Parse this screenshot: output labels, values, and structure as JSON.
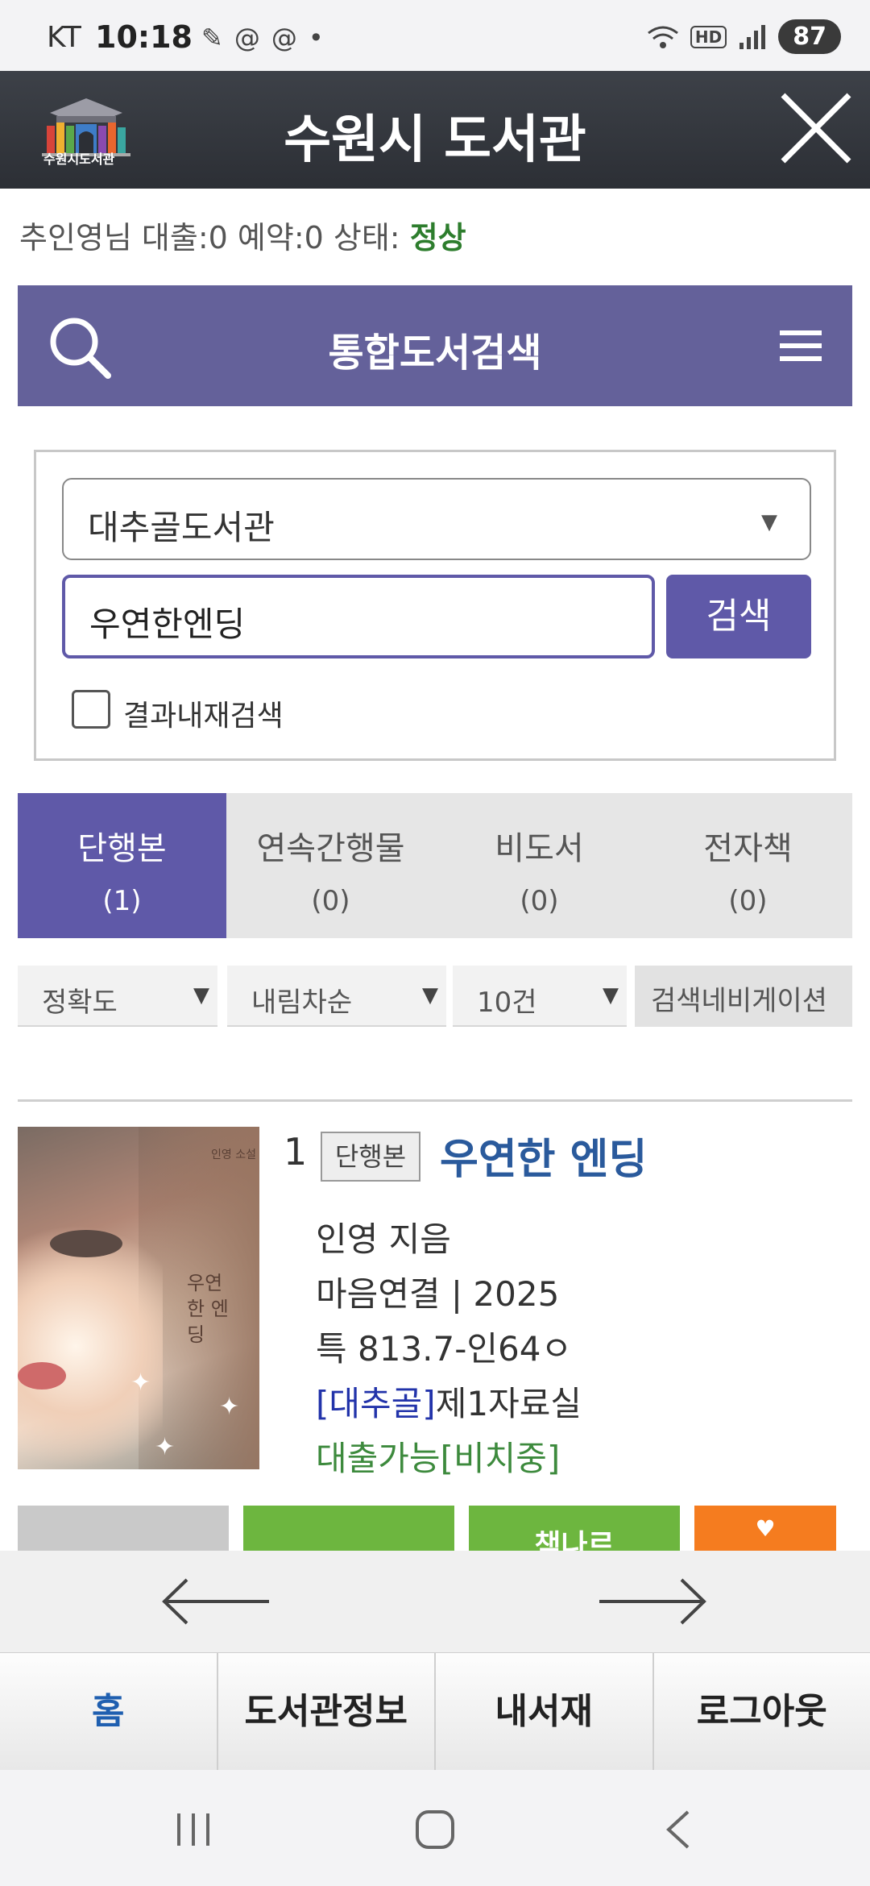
{
  "status_bar": {
    "carrier": "KT",
    "time": "10:18",
    "left_icons": [
      "pen-icon",
      "threads-icon",
      "threads-icon",
      "dot-icon"
    ],
    "right_icons": [
      "wifi-icon",
      "hd-icon",
      "signal-icon"
    ],
    "battery": "87"
  },
  "header": {
    "logo_text": "수원시도서관",
    "title": "수원시 도서관"
  },
  "user_status": {
    "prefix": "추인영님 대출:0 예약:0 상태: ",
    "state": "정상"
  },
  "search_header": {
    "title": "통합도서검색"
  },
  "search": {
    "library_selected": "대추골도서관",
    "query": "우연한엔딩",
    "button_label": "검색",
    "checkbox_label": "결과내재검색"
  },
  "tabs": [
    {
      "label": "단행본",
      "count": "(1)"
    },
    {
      "label": "연속간행물",
      "count": "(0)"
    },
    {
      "label": "비도서",
      "count": "(0)"
    },
    {
      "label": "전자책",
      "count": "(0)"
    }
  ],
  "filters": {
    "sort": "정확도",
    "order": "내림차순",
    "per_page": "10건",
    "nav": "검색네비게이션"
  },
  "result": {
    "number": "1",
    "type": "단행본",
    "title": "우연한 엔딩",
    "author": "인영 지음",
    "publisher_year": "마음연결 | 2025",
    "call_number": "특 813.7-인64ㅇ",
    "location_lib": "[대추골]",
    "location_room": "제1자료실",
    "availability": "대출가능[비치중]",
    "cover_title": "우연한 엔딩",
    "cover_author": "인영 소설",
    "partial_button": "책나르"
  },
  "bottom_menu": [
    "홈",
    "도서관정보",
    "내서재",
    "로그아웃"
  ],
  "colors": {
    "accent": "#5f59a8",
    "header_bg": "#3d4148",
    "ok_green": "#2d7d2d",
    "green_button": "#6db63f",
    "orange_button": "#f57c1f"
  }
}
